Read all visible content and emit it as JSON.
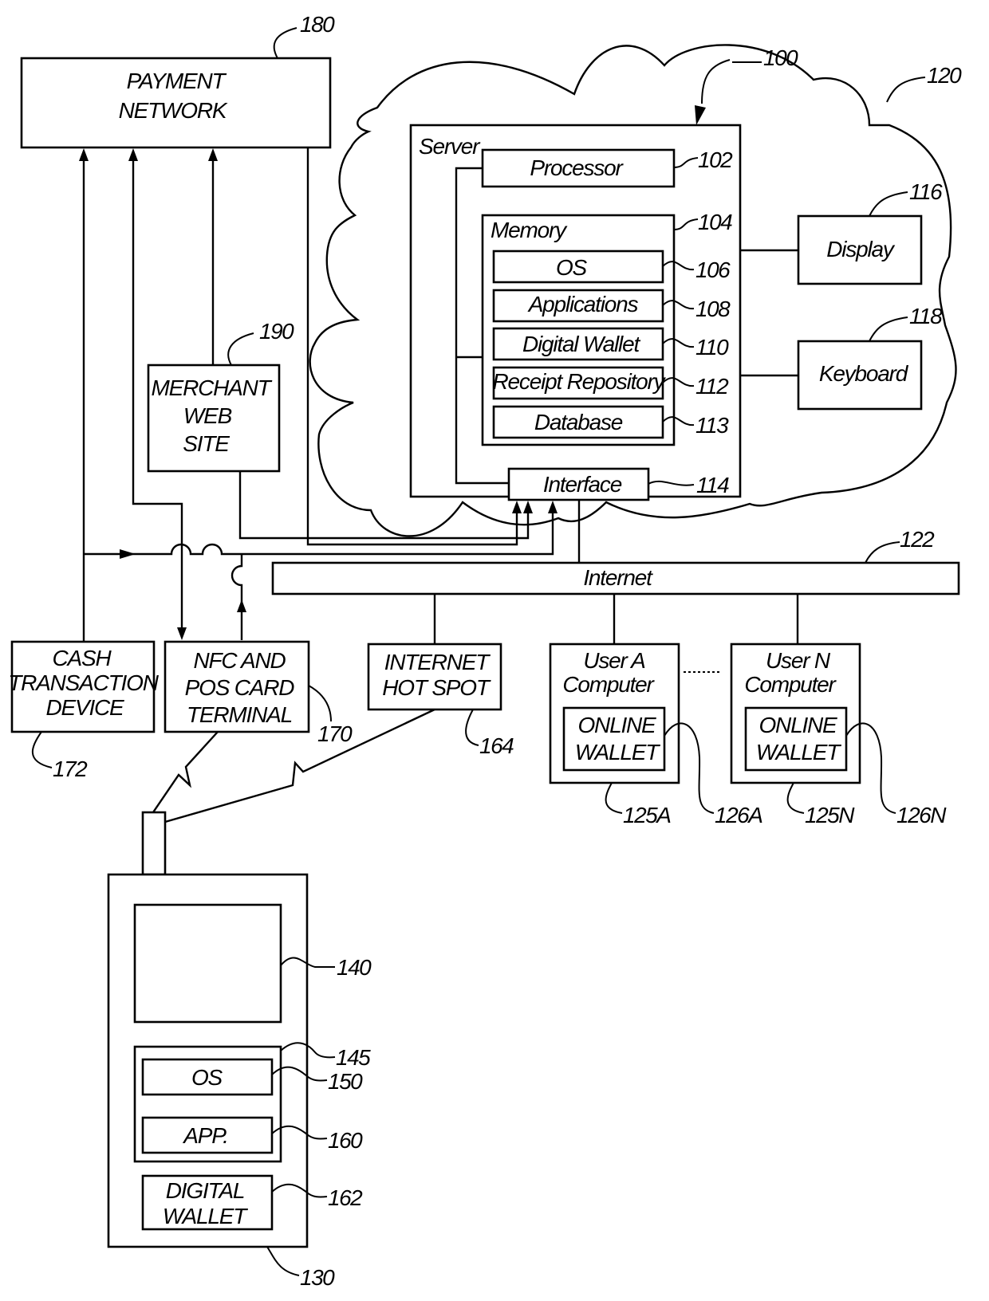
{
  "figure": {
    "payment_network": {
      "lines": [
        "PAYMENT",
        "NETWORK"
      ],
      "ref": "180"
    },
    "cloud": {
      "ref": "120"
    },
    "server": {
      "label": "Server",
      "ref": "100",
      "processor": {
        "label": "Processor",
        "ref": "102"
      },
      "memory": {
        "label": "Memory",
        "ref": "104",
        "items": [
          {
            "label": "OS",
            "ref": "106"
          },
          {
            "label": "Applications",
            "ref": "108"
          },
          {
            "label": "Digital Wallet",
            "ref": "110"
          },
          {
            "label": "Receipt Repository",
            "ref": "112"
          },
          {
            "label": "Database",
            "ref": "113"
          }
        ]
      },
      "interface": {
        "label": "Interface",
        "ref": "114"
      }
    },
    "display": {
      "label": "Display",
      "ref": "116"
    },
    "keyboard": {
      "label": "Keyboard",
      "ref": "118"
    },
    "internet": {
      "label": "Internet",
      "ref": "122"
    },
    "merchant_web_site": {
      "lines": [
        "MERCHANT",
        "WEB",
        "SITE"
      ],
      "ref": "190"
    },
    "cash_transaction_device": {
      "lines": [
        "CASH",
        "TRANSACTION",
        "DEVICE"
      ],
      "ref": "172"
    },
    "nfc_pos_terminal": {
      "lines": [
        "NFC AND",
        "POS CARD",
        "TERMINAL"
      ],
      "ref": "170"
    },
    "internet_hot_spot": {
      "lines": [
        "INTERNET",
        "HOT SPOT"
      ],
      "ref": "164"
    },
    "user_a_computer": {
      "lines": [
        "User A",
        "Computer"
      ],
      "ref": "125A",
      "wallet": {
        "lines": [
          "ONLINE",
          "WALLET"
        ],
        "ref": "126A"
      }
    },
    "user_n_computer": {
      "lines": [
        "User N",
        "Computer"
      ],
      "ref": "125N",
      "wallet": {
        "lines": [
          "ONLINE",
          "WALLET"
        ],
        "ref": "126N"
      }
    },
    "mobile_device": {
      "ref": "130",
      "screen": {
        "ref": "140"
      },
      "memory_block": {
        "ref": "145"
      },
      "os": {
        "label": "OS",
        "ref": "150"
      },
      "app": {
        "label": "APP.",
        "ref": "160"
      },
      "digital_wallet": {
        "lines": [
          "DIGITAL",
          "WALLET"
        ],
        "ref": "162"
      }
    }
  }
}
